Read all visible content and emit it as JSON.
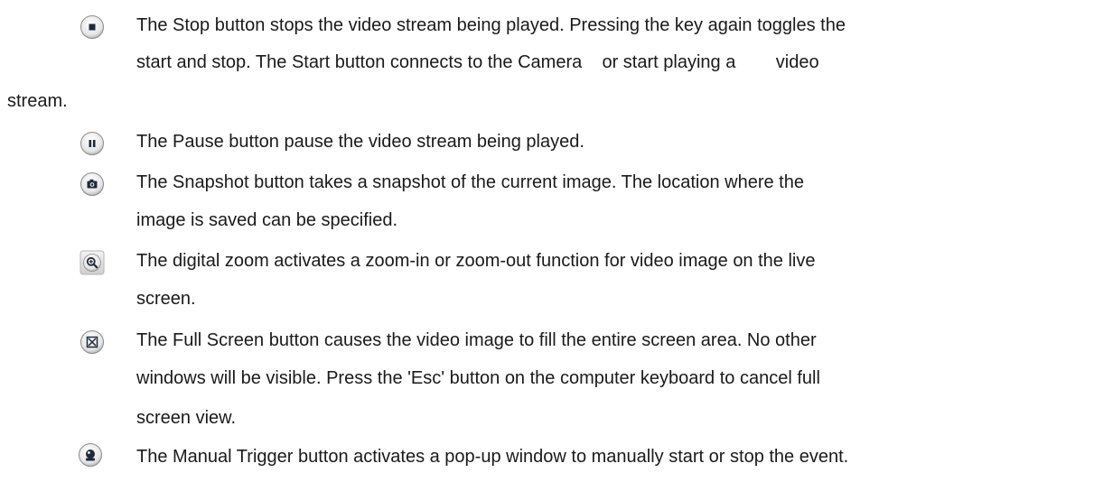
{
  "items": [
    {
      "icon": "stop-icon",
      "lines": [
        "The Stop button stops the video stream being played. Pressing the key again toggles the",
        "start and stop. The Start button connects to the Camera    or start playing a        video"
      ],
      "overflow": "stream."
    },
    {
      "icon": "pause-icon",
      "lines": [
        "The Pause button pause the video stream being played."
      ]
    },
    {
      "icon": "snapshot-icon",
      "lines": [
        "The Snapshot button takes a snapshot of the current image. The location where the",
        "image is saved can be specified."
      ]
    },
    {
      "icon": "zoom-icon",
      "lines": [
        "The digital zoom activates a zoom-in or zoom-out function for video image on the live",
        "screen."
      ]
    },
    {
      "icon": "fullscreen-icon",
      "lines": [
        "The Full Screen button causes the video image to fill the entire screen area. No other",
        "windows will be visible. Press the 'Esc' button on the computer keyboard to cancel full",
        "screen view."
      ]
    },
    {
      "icon": "manual-trigger-icon",
      "lines": [
        "The Manual Trigger button activates a pop-up window to manually start or stop the event."
      ]
    }
  ]
}
